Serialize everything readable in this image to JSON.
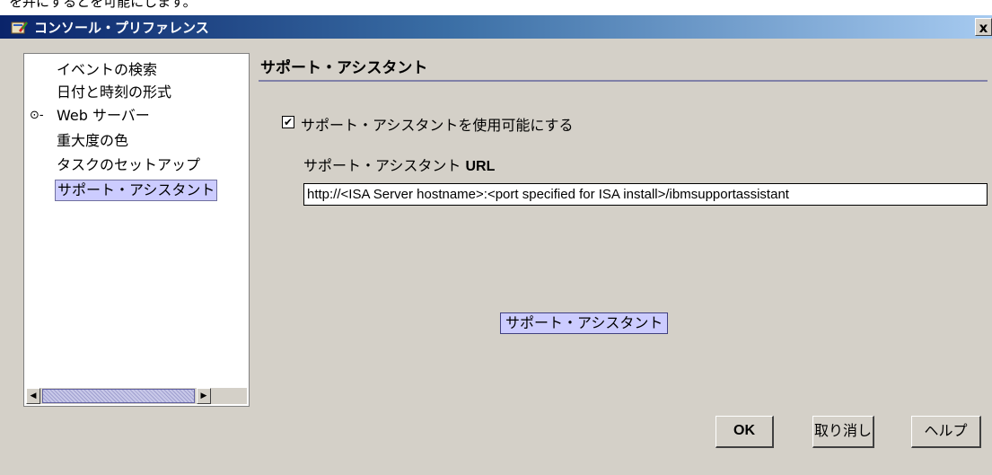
{
  "top_strip_text": "を弁にするとを可能にします。",
  "window": {
    "title": "コンソール・プリファレンス",
    "close_glyph": "x"
  },
  "tree": {
    "items": [
      {
        "label": "イベントの検索"
      },
      {
        "label": "日付と時刻の形式"
      },
      {
        "label": "Web サーバー",
        "bullet": "⊙-"
      },
      {
        "label": "重大度の色"
      },
      {
        "label": "タスクのセットアップ"
      },
      {
        "label": "サポート・アシスタント",
        "selected": true
      }
    ],
    "scroll_left": "◀",
    "scroll_right": "▶"
  },
  "panel": {
    "title": "サポート・アシスタント",
    "enable_checkbox_label": "サポート・アシスタントを使用可能にする",
    "enable_checked": true,
    "check_glyph": "✔",
    "url_label_prefix": "サポート・アシスタント ",
    "url_label_suffix": "URL",
    "url_value": "http://<ISA Server hostname>:<port specified for ISA install>/ibmsupportassistant",
    "launch_button": "サポート・アシスタント"
  },
  "buttons": {
    "ok": "OK",
    "cancel": "取り消し",
    "help": "ヘルプ"
  },
  "colors": {
    "selection": "#ccccff",
    "title_gradient_start": "#0a246a",
    "dialog_background": "#d4d0c8"
  }
}
